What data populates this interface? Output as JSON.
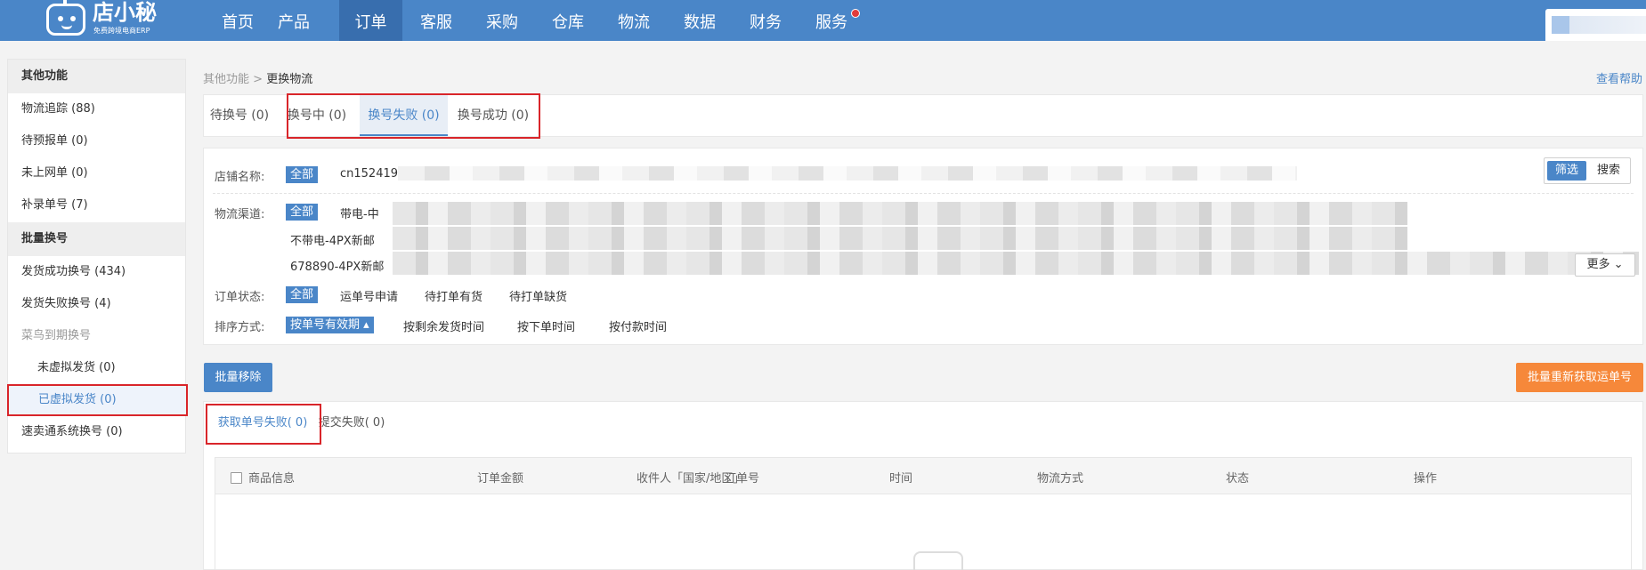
{
  "app": {
    "logo_name": "店小秘",
    "logo_sub": "免费跨境电商ERP",
    "logo_icon": "robot-icon",
    "accent": "#4a86c8",
    "nav": [
      "首页",
      "产品",
      "订单",
      "客服",
      "采购",
      "仓库",
      "物流",
      "数据",
      "财务",
      "服务"
    ],
    "nav_active": "订单"
  },
  "sidebar": {
    "section1": "其他功能",
    "items1": [
      "物流追踪 (88)",
      "待预报单 (0)",
      "未上网单 (0)",
      "补录单号 (7)"
    ],
    "section2": "批量换号",
    "items2": [
      "发货成功换号 (434)",
      "发货失败换号 (4)",
      "菜鸟到期换号",
      "未虚拟发货 (0)",
      "已虚拟发货 (0)",
      "速卖通系统换号 (0)"
    ],
    "active": "已虚拟发货 (0)"
  },
  "breadcrumb": {
    "parent": "其他功能",
    "sep": " > ",
    "current": "更换物流"
  },
  "help": "查看帮助",
  "tabs": [
    "待换号 (0)",
    "换号中 (0)",
    "换号失败 (0)",
    "换号成功 (0)"
  ],
  "tabs_active": "换号失败 (0)",
  "filters": {
    "shop_label": "店铺名称:",
    "shop_all": "全部",
    "shop_value": "cn1524195",
    "channel_label": "物流渠道:",
    "channel_all": "全部",
    "channel_opts": [
      "带电-中",
      "不带电-4PX新邮",
      "678890-4PX新邮"
    ],
    "status_label": "订单状态:",
    "status_all": "全部",
    "status_opts": [
      "运单号申请",
      "待打单有货",
      "待打单缺货"
    ],
    "sort_label": "排序方式:",
    "sort_active": "按单号有效期",
    "sort_opts": [
      "按剩余发货时间",
      "按下单时间",
      "按付款时间"
    ],
    "seg_filter": "筛选",
    "seg_search": "搜索",
    "more": "更多"
  },
  "actions": {
    "batch_remove": "批量移除",
    "batch_refetch": "批量重新获取运单号",
    "orange": "#f6883a"
  },
  "subtabs": [
    "获取单号失败( 0)",
    "提交失败( 0)"
  ],
  "subtabs_active": "获取单号失败( 0)",
  "table": {
    "columns": [
      "商品信息",
      "订单金额",
      "收件人「国家/地区」",
      "订单号",
      "时间",
      "物流方式",
      "状态",
      "操作"
    ]
  }
}
